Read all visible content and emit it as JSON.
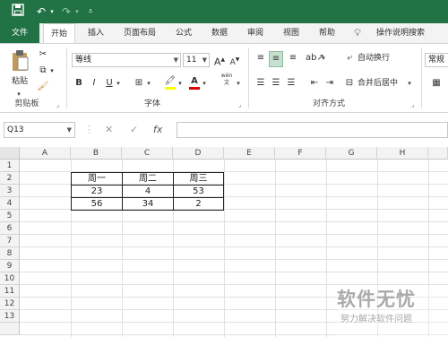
{
  "qat": {
    "save_icon": "save-icon",
    "undo_icon": "undo-icon",
    "redo_icon": "redo-icon",
    "customize_icon": "customize-icon"
  },
  "tabs": {
    "file": "文件",
    "home": "开始",
    "insert": "插入",
    "layout": "页面布局",
    "formulas": "公式",
    "data": "数据",
    "review": "审阅",
    "view": "视图",
    "help": "帮助",
    "tellme": "操作说明搜索"
  },
  "ribbon": {
    "clipboard": {
      "paste": "粘贴",
      "label": "剪贴板"
    },
    "font": {
      "name": "等线",
      "size": "11",
      "grow": "A",
      "shrink": "A",
      "bold": "B",
      "italic": "I",
      "underline": "U",
      "phonetic": "wén",
      "label": "字体"
    },
    "alignment": {
      "wrap": "自动换行",
      "merge": "合并后居中",
      "label": "对齐方式"
    },
    "number": {
      "format": "常规"
    }
  },
  "formula_bar": {
    "name_box": "Q13",
    "cancel": "✕",
    "enter": "✓",
    "fx": "fx",
    "content": ""
  },
  "grid": {
    "columns": [
      "A",
      "B",
      "C",
      "D",
      "E",
      "F",
      "G",
      "H"
    ],
    "rows": [
      "1",
      "2",
      "3",
      "4",
      "5",
      "6",
      "7",
      "8",
      "9",
      "10",
      "11",
      "12",
      "13"
    ],
    "table": {
      "header": [
        "周一",
        "周二",
        "周三"
      ],
      "row1": [
        "23",
        "4",
        "53"
      ],
      "row2": [
        "56",
        "34",
        "2"
      ]
    }
  },
  "watermark": {
    "title": "软件无忧",
    "subtitle": "努力解决软件问题"
  },
  "colors": {
    "brand": "#217346",
    "ribbon_bg": "#f3f3f3"
  }
}
